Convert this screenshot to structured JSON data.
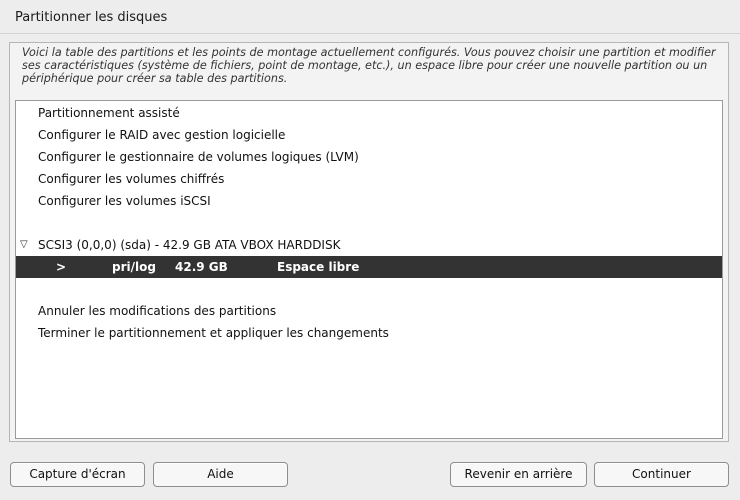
{
  "window": {
    "title": "Partitionner les disques"
  },
  "description": "Voici la table des partitions et les points de montage actuellement configurés. Vous pouvez choisir une partition et modifier ses caractéristiques (système de fichiers, point de montage, etc.), un espace libre pour créer une nouvelle partition ou un périphérique pour créer sa table des partitions.",
  "menu": {
    "guided": "Partitionnement assisté",
    "raid": "Configurer le RAID avec gestion logicielle",
    "lvm": "Configurer le gestionnaire de volumes logiques (LVM)",
    "crypto": "Configurer les volumes chiffrés",
    "iscsi": "Configurer les volumes iSCSI"
  },
  "disk": {
    "expand_icon": "triangle-down-icon",
    "label": "SCSI3 (0,0,0) (sda) - 42.9 GB ATA VBOX HARDDISK",
    "partition": {
      "marker": ">",
      "type": "pri/log",
      "size": "42.9 GB",
      "name": "Espace libre"
    }
  },
  "actions": {
    "undo": "Annuler les modifications des partitions",
    "finish": "Terminer le partitionnement et appliquer les changements"
  },
  "buttons": {
    "screenshot": "Capture d'écran",
    "help": "Aide",
    "back": "Revenir en arrière",
    "continue": "Continuer"
  }
}
